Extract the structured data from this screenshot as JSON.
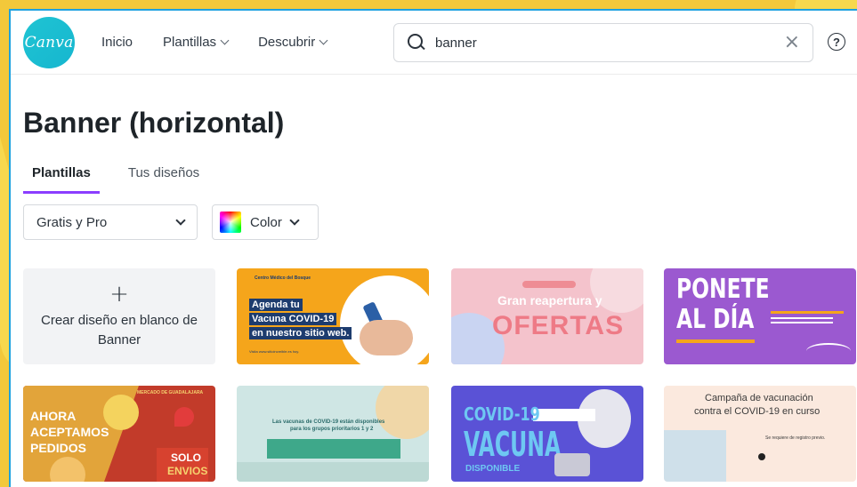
{
  "header": {
    "logo_text": "Canva",
    "nav": [
      {
        "label": "Inicio"
      },
      {
        "label": "Plantillas"
      },
      {
        "label": "Descubrir"
      }
    ],
    "search": {
      "value": "banner"
    },
    "help_label": "?"
  },
  "page": {
    "title": "Banner (horizontal)",
    "tabs": [
      {
        "label": "Plantillas",
        "active": true
      },
      {
        "label": "Tus diseños",
        "active": false
      }
    ],
    "filters": [
      {
        "label": "Gratis y Pro"
      },
      {
        "label": "Color"
      }
    ]
  },
  "blank_card": {
    "plus": "+",
    "line1": "Crear diseño en blanco de",
    "line2": "Banner"
  },
  "templates": [
    {
      "id": "vacuna-agenda",
      "bg": "#f5a51b",
      "texts": [
        "Centro Médico del Bosque",
        "Agenda tu",
        "Vacuna COVID-19",
        "en nuestro sitio web.",
        "Visita www.sitioincreible.es hoy."
      ]
    },
    {
      "id": "gran-reapertura",
      "bg": "#f4c3cc",
      "texts": [
        "Gran reapertura y",
        "OFERTAS"
      ]
    },
    {
      "id": "ponete-al-dia",
      "bg": "#9b59d0",
      "texts": [
        "PONETE",
        "AL DÍA"
      ]
    },
    {
      "id": "ahora-aceptamos",
      "bg": "#c23b2a",
      "texts": [
        "MERCADO DE GUADALAJARA",
        "AHORA",
        "ACEPTAMOS",
        "PEDIDOS",
        "SOLO",
        "ENVIOS"
      ]
    },
    {
      "id": "vacunas-prioritarios",
      "bg": "#cfe6e4",
      "texts": [
        "Las vacunas de COVID-19 están disponibles",
        "para los grupos prioritarios 1 y 2"
      ]
    },
    {
      "id": "vacuna-disponible",
      "bg": "#5a52d6",
      "texts": [
        "COVID-19",
        "VACUNA",
        "DISPONIBLE"
      ]
    },
    {
      "id": "campana-vacunacion",
      "bg": "#fbe9de",
      "texts": [
        "Campaña de vacunación",
        "contra el COVID-19 en curso",
        "Se requiere de registro previo."
      ]
    }
  ],
  "colors": {
    "accent": "#8b3dff",
    "logo": "#1fc4d3",
    "window_border": "#1da1e0",
    "background": "#f3c83a"
  }
}
